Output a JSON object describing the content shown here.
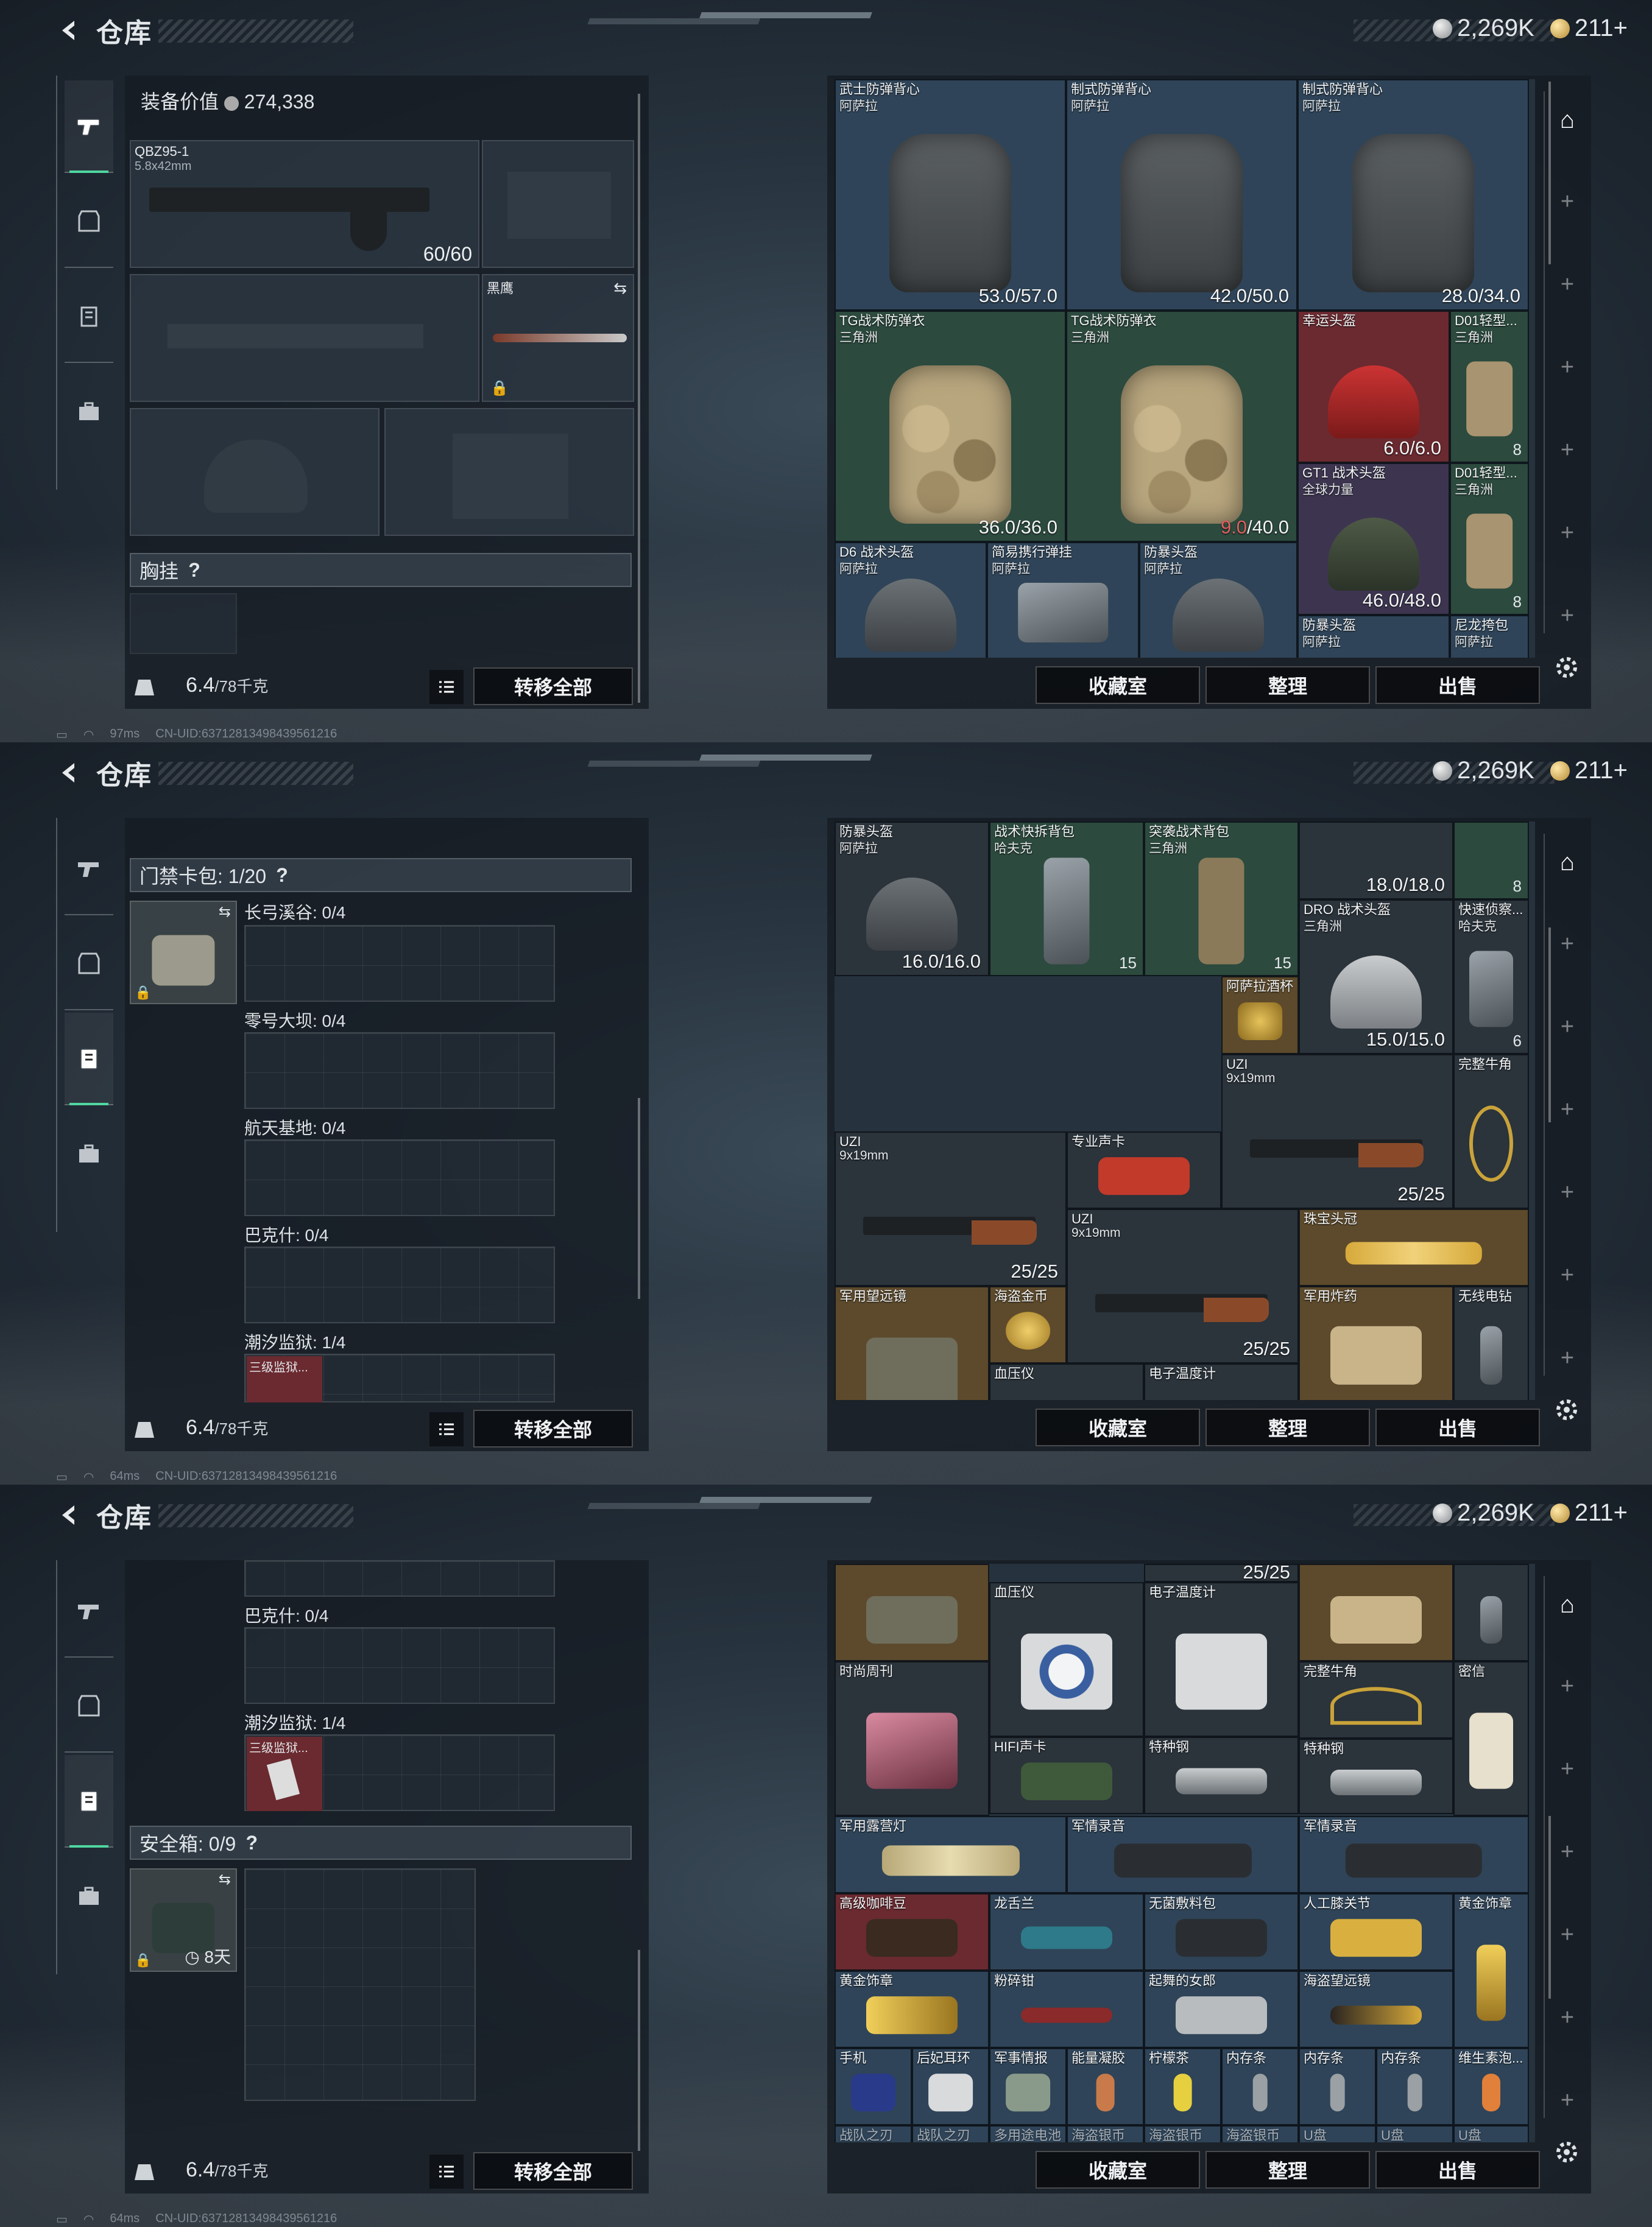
{
  "header": {
    "title": "仓库",
    "silver": "2,269K",
    "gold": "211+"
  },
  "net": {
    "ping1": "97ms",
    "ping2": "64ms",
    "ping3": "64ms",
    "uid": "CN-UID:63712813498439561216"
  },
  "footer": {
    "weight": "6.4",
    "weight_max": "/78千克",
    "transfer": "转移全部",
    "collection": "收藏室",
    "sort": "整理",
    "sell": "出售"
  },
  "screen1": {
    "equip_value_label": "装备价值",
    "equip_value": "274,338",
    "primary": {
      "name": "QBZ95-1",
      "ammo_type": "5.8x42mm",
      "ammo": "60/60"
    },
    "melee": {
      "name": "黑鹰"
    },
    "chest": {
      "label": "胸挂"
    },
    "items": [
      {
        "n": "武士防弹背心",
        "s": "阿萨拉",
        "d": "53.0/57.0"
      },
      {
        "n": "制式防弹背心",
        "s": "阿萨拉",
        "d": "42.0/50.0"
      },
      {
        "n": "制式防弹背心",
        "s": "阿萨拉",
        "d": "28.0/34.0"
      },
      {
        "n": "TG战术防弹衣",
        "s": "三角洲",
        "d": "36.0/36.0"
      },
      {
        "n": "TG战术防弹衣",
        "s": "三角洲",
        "d_red": "9.0",
        "d": "/40.0"
      },
      {
        "n": "幸运头盔",
        "s": "",
        "d": "6.0/6.0"
      },
      {
        "n": "D01轻型...",
        "s": "三角洲",
        "t": "8"
      },
      {
        "n": "GT1 战术头盔",
        "s": "全球力量",
        "d": "46.0/48.0"
      },
      {
        "n": "D01轻型...",
        "s": "三角洲",
        "t": "8"
      },
      {
        "n": "D6 战术头盔",
        "s": "阿萨拉"
      },
      {
        "n": "简易携行弹挂",
        "s": "阿萨拉"
      },
      {
        "n": "防暴头盔",
        "s": "阿萨拉"
      },
      {
        "n": "防暴头盔",
        "s": "阿萨拉"
      },
      {
        "n": "尼龙挎包",
        "s": "阿萨拉"
      }
    ]
  },
  "screen2": {
    "keycard_label": "门禁卡包: 1/20",
    "maps": [
      "长弓溪谷: 0/4",
      "零号大坝: 0/4",
      "航天基地: 0/4",
      "巴克什: 0/4",
      "潮汐监狱: 1/4"
    ],
    "card_name": "三级监狱...",
    "items": [
      {
        "n": "防暴头盔",
        "s": "阿萨拉",
        "d": "16.0/16.0"
      },
      {
        "n": "战术快拆背包",
        "s": "哈夫克",
        "t": "15"
      },
      {
        "n": "突袭战术背包",
        "s": "三角洲",
        "t": "15"
      },
      {
        "n": "",
        "s": "",
        "d": "18.0/18.0"
      },
      {
        "n": "",
        "s": "",
        "t": "8"
      },
      {
        "n": "DRO 战术头盔",
        "s": "三角洲",
        "d": "15.0/15.0"
      },
      {
        "n": "快速侦察...",
        "s": "哈夫克",
        "t": "6"
      },
      {
        "n": "阿萨拉酒杯",
        "s": ""
      },
      {
        "n": "UZI",
        "s": "9x19mm",
        "d": "25/25"
      },
      {
        "n": "完整牛角",
        "s": ""
      },
      {
        "n": "UZI",
        "s": "9x19mm",
        "d": "25/25"
      },
      {
        "n": "专业声卡",
        "s": ""
      },
      {
        "n": "UZI",
        "s": "9x19mm",
        "d": "25/25"
      },
      {
        "n": "珠宝头冠",
        "s": ""
      },
      {
        "n": "军用望远镜",
        "s": ""
      },
      {
        "n": "海盗金币",
        "s": ""
      },
      {
        "n": "血压仪",
        "s": ""
      },
      {
        "n": "电子温度计",
        "s": ""
      },
      {
        "n": "军用炸药",
        "s": ""
      },
      {
        "n": "无线电钻",
        "s": ""
      }
    ]
  },
  "screen3": {
    "maps": [
      "巴克什: 0/4",
      "潮汐监狱: 1/4"
    ],
    "card_name": "三级监狱...",
    "safe_label": "安全箱: 0/9",
    "safe_timer": "8天",
    "items": [
      {
        "n": "",
        "d": "25/25"
      },
      {
        "n": "血压仪"
      },
      {
        "n": "电子温度计"
      },
      {
        "n": "时尚周刊"
      },
      {
        "n": "完整牛角"
      },
      {
        "n": "密信"
      },
      {
        "n": "HIFI声卡"
      },
      {
        "n": "特种钢"
      },
      {
        "n": "特种钢"
      },
      {
        "n": "军用露营灯"
      },
      {
        "n": "军情录音"
      },
      {
        "n": "军情录音"
      },
      {
        "n": "高级咖啡豆"
      },
      {
        "n": "龙舌兰"
      },
      {
        "n": "无菌敷料包"
      },
      {
        "n": "人工膝关节"
      },
      {
        "n": "黄金饰章"
      },
      {
        "n": "黄金饰章"
      },
      {
        "n": "粉碎钳"
      },
      {
        "n": "起舞的女郎"
      },
      {
        "n": "海盗望远镜"
      },
      {
        "n": "手机"
      },
      {
        "n": "后妃耳环"
      },
      {
        "n": "军事情报"
      },
      {
        "n": "能量凝胶"
      },
      {
        "n": "柠檬茶"
      },
      {
        "n": "内存条"
      },
      {
        "n": "内存条"
      },
      {
        "n": "内存条"
      },
      {
        "n": "维生素泡..."
      },
      {
        "n": "战队之刃"
      },
      {
        "n": "战队之刃"
      },
      {
        "n": "多用途电池"
      },
      {
        "n": "海盗银币"
      },
      {
        "n": "海盗银币"
      },
      {
        "n": "海盗银币"
      },
      {
        "n": "U盘"
      },
      {
        "n": "U盘"
      },
      {
        "n": "U盘"
      }
    ]
  }
}
